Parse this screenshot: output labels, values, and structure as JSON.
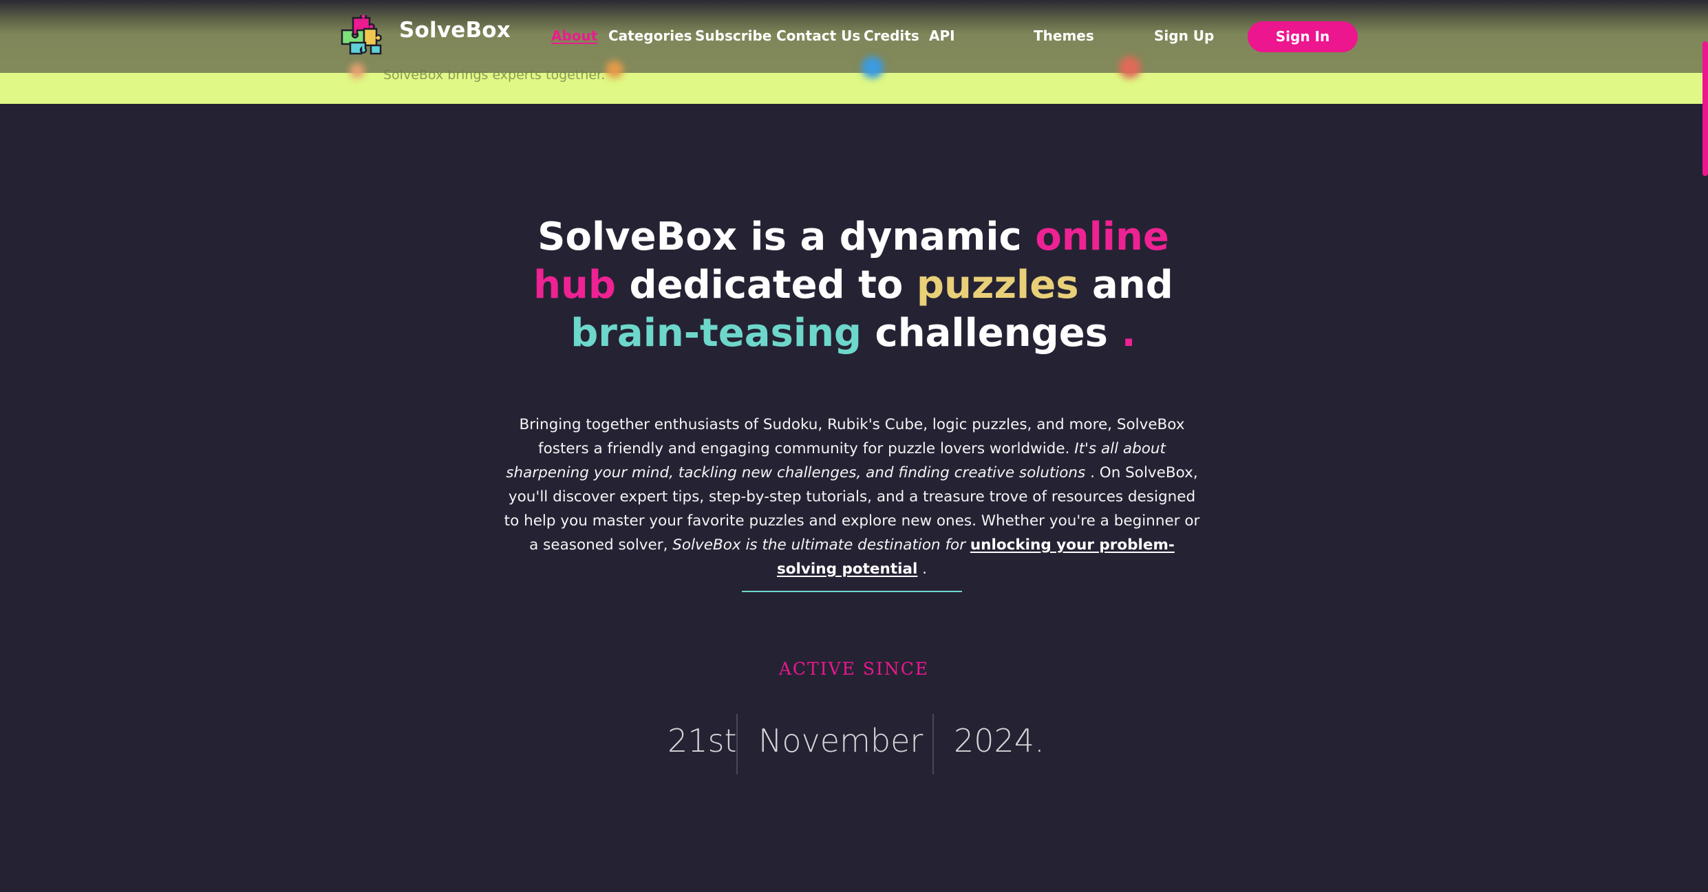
{
  "header": {
    "brand": "SolveBox",
    "nav": [
      {
        "label": "About",
        "active": true
      },
      {
        "label": "Categories"
      },
      {
        "label": "Subscribe"
      },
      {
        "label": "Contact Us"
      },
      {
        "label": "Credits"
      },
      {
        "label": "API"
      },
      {
        "label": "Themes"
      },
      {
        "label": "Sign Up"
      }
    ],
    "signin_label": "Sign In",
    "ghost_tagline": "SolveBox brings experts together."
  },
  "hero": {
    "headline": {
      "p1": "SolveBox is a dynamic ",
      "p2": "online hub",
      "p3": " dedicated to ",
      "p4": "puzzles",
      "p5": " and ",
      "p6": "brain-teasing",
      "p7": " challenges ",
      "p8": "."
    },
    "paragraph": {
      "t1": "Bringing together enthusiasts of Sudoku, Rubik's Cube, logic puzzles, and more, SolveBox fosters a friendly and engaging community for puzzle lovers worldwide. ",
      "t2": "It's all about sharpening your mind, tackling new challenges, and finding creative solutions",
      "t3": " . On SolveBox, you'll discover expert tips, step-by-step tutorials, and a treasure trove of resources designed to help you master your favorite puzzles and explore new ones. Whether you're a beginner or a seasoned solver, ",
      "t4": "SolveBox is the ultimate destination for ",
      "link": "unlocking your problem-solving potential",
      "t5": " ."
    },
    "active_since": {
      "label": "ACTIVE SINCE",
      "day": "21st",
      "month": "November",
      "year": "2024."
    }
  },
  "colors": {
    "background": "#252333",
    "accent_pink": "#ec168e",
    "accent_yellow": "#e9cf78",
    "accent_teal": "#6ed7cc",
    "lime_band": "#e0f885"
  },
  "icons": {
    "logo": "puzzle-pieces-icon"
  }
}
